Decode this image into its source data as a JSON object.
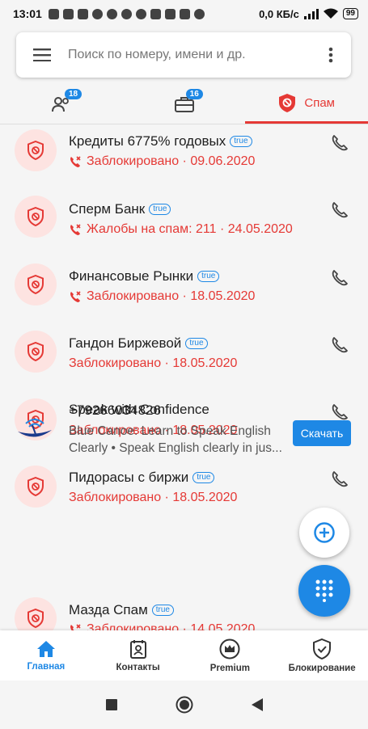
{
  "status_bar": {
    "time": "13:01",
    "network_speed": "0,0 КБ/с",
    "battery": "99"
  },
  "search": {
    "placeholder": "Поиск по номеру, имени и др."
  },
  "tabs": [
    {
      "icon": "contacts-icon",
      "badge": "18"
    },
    {
      "icon": "inbox-icon",
      "badge": "16"
    },
    {
      "icon": "spam-shield-icon",
      "label": "Спам",
      "active": true
    }
  ],
  "calls": [
    {
      "name": "Кредиты 6775% годовых",
      "tag": "true",
      "status": "Заблокировано · 09.06.2020",
      "has_icon": true
    },
    {
      "name": "Сперм Банк",
      "tag": "true",
      "status": "Жалобы на спам: 211 · 24.05.2020",
      "has_icon": true
    },
    {
      "name": "Финансовые Рынки",
      "tag": "true",
      "status": "Заблокировано · 18.05.2020",
      "has_icon": true
    },
    {
      "name": "Гандон Биржевой",
      "tag": "true",
      "status": "Заблокировано · 18.05.2020",
      "has_icon": false
    },
    {
      "name": "+79266034826",
      "tag": "",
      "status": "Заблокировано · 18.05.2020",
      "has_icon": false
    },
    {
      "name": "Пидорасы с биржи",
      "tag": "true",
      "status": "Заблокировано · 18.05.2020",
      "has_icon": false
    },
    {
      "name": "Мазда Спам",
      "tag": "true",
      "status": "Заблокировано · 14.05.2020",
      "has_icon": true
    }
  ],
  "ad": {
    "title": "Speak with Confidence",
    "text": "Blue Canoe: Learn to Speak English Clearly • Speak English clearly in jus...",
    "button": "Скачать"
  },
  "bottom_nav": [
    {
      "label": "Главная",
      "icon": "home-icon",
      "active": true
    },
    {
      "label": "Контакты",
      "icon": "contacts-book-icon"
    },
    {
      "label": "Premium",
      "icon": "crown-icon"
    },
    {
      "label": "Блокирование",
      "icon": "shield-check-icon"
    }
  ],
  "colors": {
    "accent": "#1e88e5",
    "spam_red": "#e53935",
    "avatar_bg": "#fde3e1"
  }
}
